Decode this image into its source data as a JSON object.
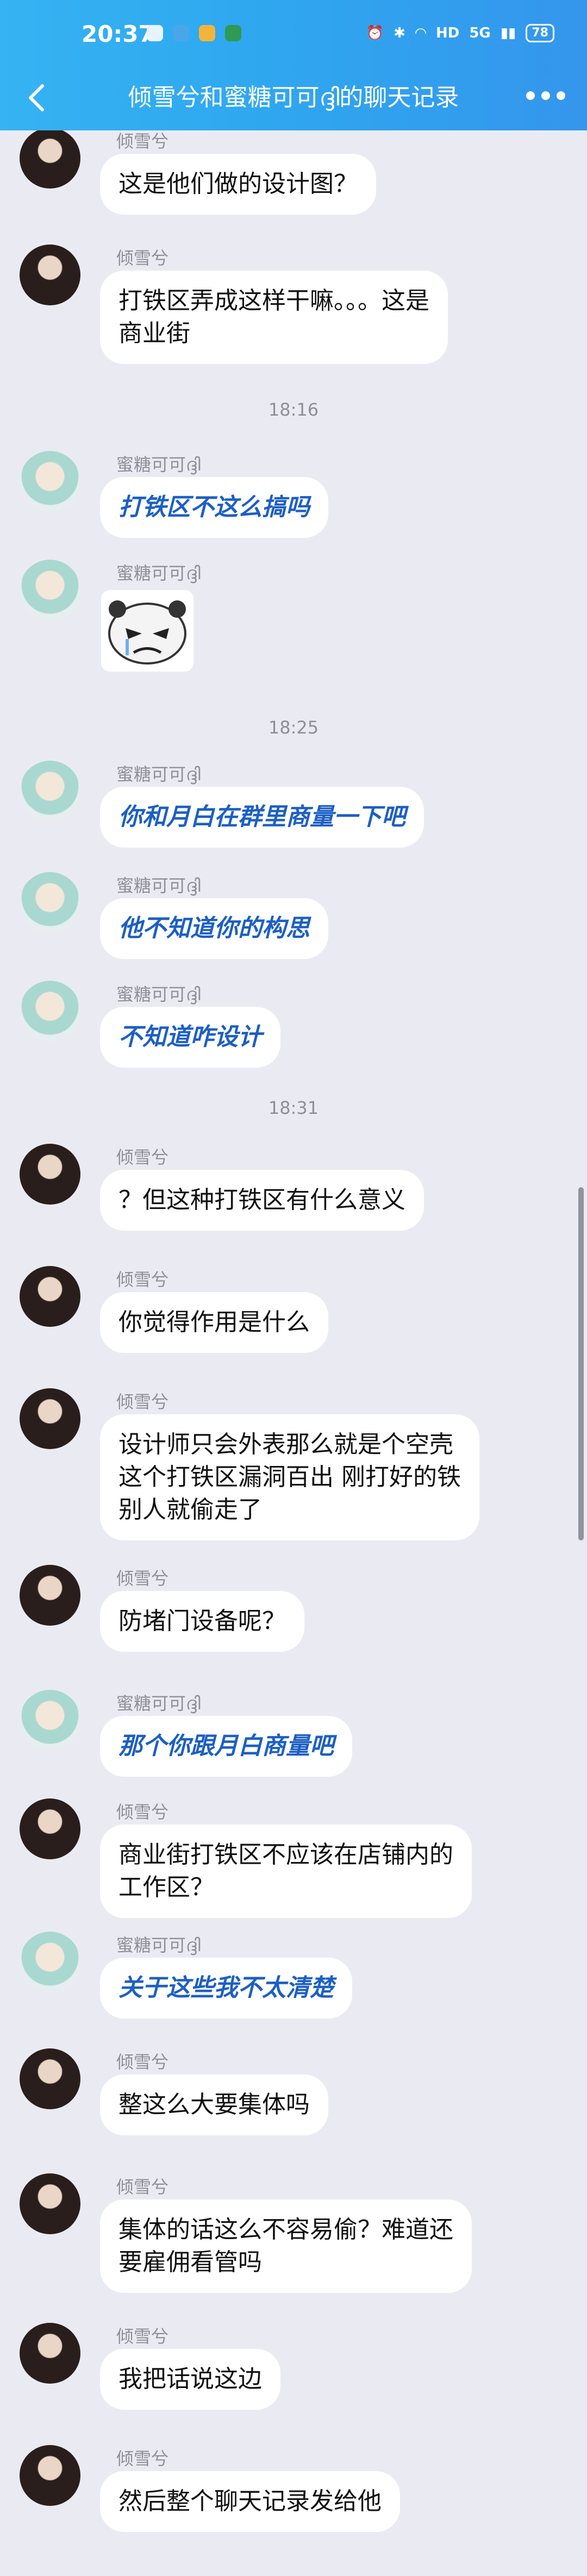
{
  "status": {
    "time": "20:37",
    "battery": "78",
    "signal": "5G",
    "hd": "HD"
  },
  "header": {
    "title": "倾雪兮和蜜糖可可ദ്ദി的聊天记录"
  },
  "names": {
    "a": "倾雪兮",
    "b": "蜜糖可可ദ്ദി"
  },
  "messages": [
    {
      "sender": "a",
      "text": "这是他们做的设计图？",
      "style": "normal"
    },
    {
      "sender": "a",
      "text": "打铁区弄成这样干嘛。。。这是\n商业街",
      "style": "normal"
    },
    {
      "time": "18:16"
    },
    {
      "sender": "b",
      "text": "打铁区不这么搞吗",
      "style": "blue"
    },
    {
      "sender": "b",
      "sticker": "angry-panda-sticker"
    },
    {
      "time": "18:25"
    },
    {
      "sender": "b",
      "text": "你和月白在群里商量一下吧",
      "style": "blue"
    },
    {
      "sender": "b",
      "text": "他不知道你的构思",
      "style": "blue"
    },
    {
      "sender": "b",
      "text": "不知道咋设计",
      "style": "blue"
    },
    {
      "time": "18:31"
    },
    {
      "sender": "a",
      "text": "？但这种打铁区有什么意义",
      "style": "normal"
    },
    {
      "sender": "a",
      "text": "你觉得作用是什么",
      "style": "normal"
    },
    {
      "sender": "a",
      "text": "设计师只会外表那么就是个空壳\n这个打铁区漏洞百出 刚打好的铁\n别人就偷走了",
      "style": "normal"
    },
    {
      "sender": "a",
      "text": "防堵门设备呢？",
      "style": "normal"
    },
    {
      "sender": "b",
      "text": "那个你跟月白商量吧",
      "style": "blue"
    },
    {
      "sender": "a",
      "text": "商业街打铁区不应该在店铺内的\n工作区？",
      "style": "normal"
    },
    {
      "sender": "b",
      "text": "关于这些我不太清楚",
      "style": "blue"
    },
    {
      "sender": "a",
      "text": "整这么大要集体吗",
      "style": "normal"
    },
    {
      "sender": "a",
      "text": "集体的话这么不容易偷？难道还\n要雇佣看管吗",
      "style": "normal"
    },
    {
      "sender": "a",
      "text": "我把话说这边",
      "style": "normal"
    },
    {
      "sender": "a",
      "text": "然后整个聊天记录发给他",
      "style": "normal"
    }
  ]
}
